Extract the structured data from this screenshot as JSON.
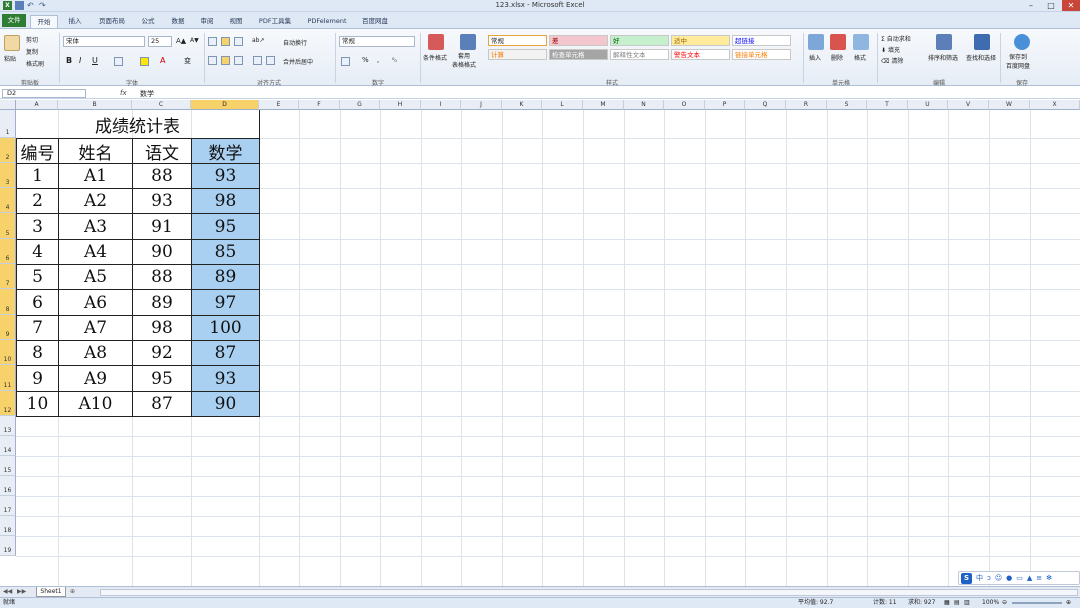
{
  "window": {
    "title": "123.xlsx - Microsoft Excel",
    "buttons": [
      "–",
      "□",
      "✕"
    ]
  },
  "tabs": [
    "文件",
    "开始",
    "插入",
    "页面布局",
    "公式",
    "数据",
    "审阅",
    "视图",
    "PDF工具集",
    "PDFelement",
    "百度网盘"
  ],
  "active_tab_index": 1,
  "ribbon": {
    "clipboard": {
      "paste": "粘贴",
      "cut": "剪切",
      "copy": "复制",
      "format_painter": "格式刷",
      "label": "剪贴板"
    },
    "font": {
      "name": "宋体",
      "size": "25",
      "label": "字体",
      "bold": "B",
      "italic": "I",
      "underline": "U"
    },
    "alignment": {
      "wrap": "自动换行",
      "merge": "合并后居中",
      "label": "对齐方式"
    },
    "number": {
      "format": "常规",
      "percent": "%",
      "comma": ",",
      "label": "数字"
    },
    "styles": {
      "conditional": "条件格式",
      "table": "套用\n表格格式",
      "cells": [
        {
          "text": "常规",
          "color": "#ffffff",
          "fg": "#222222"
        },
        {
          "text": "差",
          "color": "#f4c7ce",
          "fg": "#9c0006"
        },
        {
          "text": "好",
          "color": "#c6efce",
          "fg": "#006100"
        },
        {
          "text": "适中",
          "color": "#ffeb9c",
          "fg": "#9c6500"
        },
        {
          "text": "超链接",
          "color": "#ffffff",
          "fg": "#0000ff"
        },
        {
          "text": "计算",
          "color": "#f2f2f2",
          "fg": "#fa7d00"
        },
        {
          "text": "检查单元格",
          "color": "#a5a5a5",
          "fg": "#ffffff"
        },
        {
          "text": "解释性文本",
          "color": "#ffffff",
          "fg": "#7f7f7f"
        },
        {
          "text": "警告文本",
          "color": "#ffffff",
          "fg": "#ff0000"
        },
        {
          "text": "链接单元格",
          "color": "#ffffff",
          "fg": "#fa7d00"
        }
      ],
      "label": "样式"
    },
    "cells_group": {
      "insert": "插入",
      "delete": "删除",
      "format": "格式",
      "label": "单元格"
    },
    "editing": {
      "autosum": "自动求和",
      "fill": "填充",
      "clear": "清除",
      "sort": "排序和筛选",
      "find": "查找和选择",
      "label": "编辑"
    },
    "save": {
      "label_btn": "保存到\n百度网盘",
      "label": "保存"
    }
  },
  "formula_bar": {
    "name_box": "D2",
    "fx": "fx",
    "content": "数学"
  },
  "columns": [
    "A",
    "B",
    "C",
    "D",
    "E",
    "F",
    "G",
    "H",
    "I",
    "J",
    "K",
    "L",
    "M",
    "N",
    "O",
    "P",
    "Q",
    "R",
    "S",
    "T",
    "U",
    "V",
    "W",
    "X"
  ],
  "rows": [
    "1",
    "2",
    "3",
    "4",
    "5",
    "6",
    "7",
    "8",
    "9",
    "10",
    "11",
    "12",
    "13",
    "14",
    "15",
    "16",
    "17",
    "18",
    "19"
  ],
  "sheet": {
    "title": "成绩统计表",
    "headers": [
      "编号",
      "姓名",
      "语文",
      "数学"
    ],
    "data": [
      [
        "1",
        "A1",
        "88",
        "93"
      ],
      [
        "2",
        "A2",
        "93",
        "98"
      ],
      [
        "3",
        "A3",
        "91",
        "95"
      ],
      [
        "4",
        "A4",
        "90",
        "85"
      ],
      [
        "5",
        "A5",
        "88",
        "89"
      ],
      [
        "6",
        "A6",
        "89",
        "97"
      ],
      [
        "7",
        "A7",
        "98",
        "100"
      ],
      [
        "8",
        "A8",
        "92",
        "87"
      ],
      [
        "9",
        "A9",
        "95",
        "93"
      ],
      [
        "10",
        "A10",
        "87",
        "90"
      ]
    ]
  },
  "sheet_tab": "Sheet1",
  "status": {
    "ready": "就绪",
    "average": "平均值: 92.7",
    "count": "计数: 11",
    "sum": "求和: 927",
    "zoom": "100%"
  },
  "ime": {
    "logo": "S",
    "mode": "中"
  },
  "colors": {
    "selection": "#a9d0f1",
    "header_selected": "#f7d16a",
    "file_tab": "#2e7d32"
  }
}
